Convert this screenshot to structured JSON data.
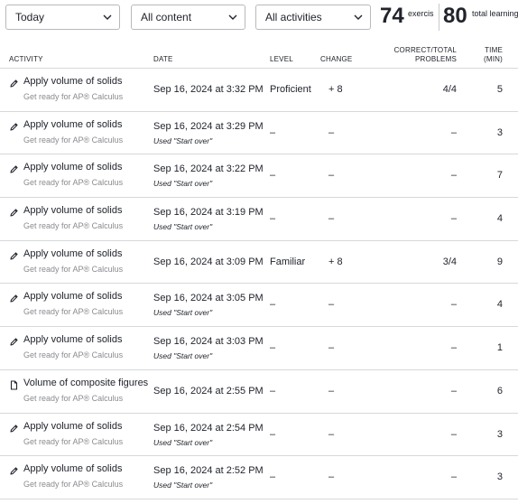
{
  "filters": {
    "date": "Today",
    "content": "All content",
    "activity": "All activities"
  },
  "stats": {
    "exercise_minutes": {
      "value": "74",
      "label": "exercis min"
    },
    "total_learning": {
      "value": "80",
      "label": "total learning..."
    }
  },
  "table": {
    "headers": {
      "activity": "ACTIVITY",
      "date": "DATE",
      "level": "LEVEL",
      "change": "CHANGE",
      "correct_line1": "CORRECT/TOTAL",
      "correct_line2": "PROBLEMS",
      "time_line1": "TIME",
      "time_line2": "(MIN)"
    },
    "rows": [
      {
        "icon": "pencil-icon",
        "title": "Apply volume of solids",
        "course": "Get ready for AP® Calculus",
        "date": "Sep 16, 2024 at 3:32 PM",
        "note": "",
        "level": "Proficient",
        "change": "+ 8",
        "correct": "4/4",
        "time": "5"
      },
      {
        "icon": "pencil-icon",
        "title": "Apply volume of solids",
        "course": "Get ready for AP® Calculus",
        "date": "Sep 16, 2024 at 3:29 PM",
        "note": "Used \"Start over\"",
        "level": "–",
        "change": "–",
        "correct": "–",
        "time": "3"
      },
      {
        "icon": "pencil-icon",
        "title": "Apply volume of solids",
        "course": "Get ready for AP® Calculus",
        "date": "Sep 16, 2024 at 3:22 PM",
        "note": "Used \"Start over\"",
        "level": "–",
        "change": "–",
        "correct": "–",
        "time": "7"
      },
      {
        "icon": "pencil-icon",
        "title": "Apply volume of solids",
        "course": "Get ready for AP® Calculus",
        "date": "Sep 16, 2024 at 3:19 PM",
        "note": "Used \"Start over\"",
        "level": "–",
        "change": "–",
        "correct": "–",
        "time": "4"
      },
      {
        "icon": "pencil-icon",
        "title": "Apply volume of solids",
        "course": "Get ready for AP® Calculus",
        "date": "Sep 16, 2024 at 3:09 PM",
        "note": "",
        "level": "Familiar",
        "change": "+ 8",
        "correct": "3/4",
        "time": "9"
      },
      {
        "icon": "pencil-icon",
        "title": "Apply volume of solids",
        "course": "Get ready for AP® Calculus",
        "date": "Sep 16, 2024 at 3:05 PM",
        "note": "Used \"Start over\"",
        "level": "–",
        "change": "–",
        "correct": "–",
        "time": "4"
      },
      {
        "icon": "pencil-icon",
        "title": "Apply volume of solids",
        "course": "Get ready for AP® Calculus",
        "date": "Sep 16, 2024 at 3:03 PM",
        "note": "Used \"Start over\"",
        "level": "–",
        "change": "–",
        "correct": "–",
        "time": "1"
      },
      {
        "icon": "document-icon",
        "title": "Volume of composite figures",
        "course": "Get ready for AP® Calculus",
        "date": "Sep 16, 2024 at 2:55 PM",
        "note": "",
        "level": "–",
        "change": "–",
        "correct": "–",
        "time": "6"
      },
      {
        "icon": "pencil-icon",
        "title": "Apply volume of solids",
        "course": "Get ready for AP® Calculus",
        "date": "Sep 16, 2024 at 2:54 PM",
        "note": "Used \"Start over\"",
        "level": "–",
        "change": "–",
        "correct": "–",
        "time": "3"
      },
      {
        "icon": "pencil-icon",
        "title": "Apply volume of solids",
        "course": "Get ready for AP® Calculus",
        "date": "Sep 16, 2024 at 2:52 PM",
        "note": "Used \"Start over\"",
        "level": "–",
        "change": "–",
        "correct": "–",
        "time": "3"
      }
    ]
  }
}
